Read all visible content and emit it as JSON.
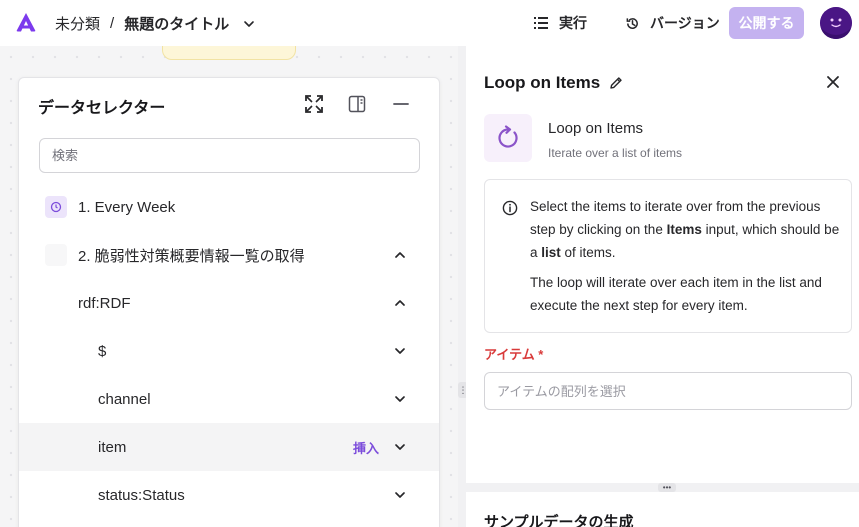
{
  "header": {
    "breadcrumb_folder": "未分類",
    "breadcrumb_sep": "/",
    "breadcrumb_title": "無題のタイトル",
    "run_label": "実行",
    "version_label": "バージョン",
    "publish_label": "公開する",
    "accent_color": "#c4b2f0"
  },
  "selector": {
    "title": "データセレクター",
    "search_placeholder": "検索",
    "items": [
      {
        "label": "1. Every Week",
        "icon": "clock-icon"
      },
      {
        "label": "2. 脆弱性対策概要情報一覧の取得",
        "chevron": "up"
      },
      {
        "label": "rdf:RDF",
        "chevron": "up"
      },
      {
        "label": "$",
        "chevron": "down"
      },
      {
        "label": "channel",
        "chevron": "down"
      },
      {
        "label": "item",
        "chevron": "down",
        "action": "挿入"
      },
      {
        "label": "status:Status",
        "chevron": "down"
      }
    ]
  },
  "panel": {
    "title": "Loop on Items",
    "step_name": "Loop on Items",
    "step_desc": "Iterate over a list of items",
    "info_p1_a": "Select the items to iterate over from the previous step by clicking on the ",
    "info_p1_b": "Items",
    "info_p1_c": " input, which should be a ",
    "info_p1_d": "list",
    "info_p1_e": " of items.",
    "info_p2": "The loop will iterate over each item in the list and execute the next step for every item.",
    "field_label": "アイテム *",
    "field_placeholder": "アイテムの配列を選択",
    "sample_title": "サンプルデータの生成"
  }
}
